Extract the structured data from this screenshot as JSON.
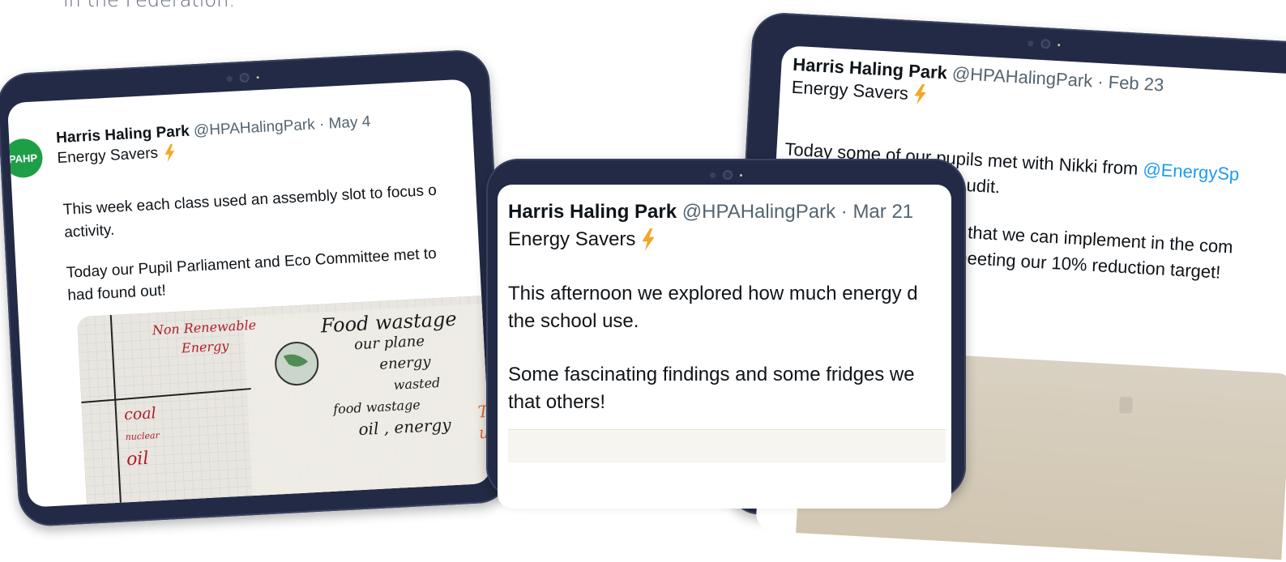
{
  "intro_text": "in the Federation.",
  "colors": {
    "frame": "#232a45",
    "bolt": "#f5a623",
    "handle": "#536471",
    "mention": "#1d9bf0",
    "avatar": "#1e9f47"
  },
  "tweets": [
    {
      "account": "Harris Haling Park",
      "handle": "@HPAHalingPark",
      "date": "May 4",
      "avatar_text": "PAHP",
      "subtitle": "Energy Savers",
      "icon": "lightning-bolt-icon",
      "para1": [
        "This week each class used an assembly slot to focus o",
        "activity."
      ],
      "para2": [
        "Today our Pupil Parliament and Eco Committee met to",
        "had found out!"
      ],
      "photo_text": {
        "left_heading": [
          "Non Renewable",
          "Energy"
        ],
        "left_items": [
          "coal",
          "nuclear",
          "oil"
        ],
        "right_lines": [
          "Food wastage",
          "our plane",
          "energy",
          "wasted",
          "food wastage",
          "oil , energy"
        ],
        "edge_letters": [
          "Th",
          "u"
        ]
      }
    },
    {
      "account": "Harris Haling Park",
      "handle": "@HPAHalingPark",
      "date": "Mar 21",
      "subtitle": "Energy Savers",
      "icon": "lightning-bolt-icon",
      "para1": [
        "This afternoon we explored how much energy d",
        "the school use."
      ],
      "para2": [
        "Some fascinating findings and some fridges we",
        "that others!"
      ]
    },
    {
      "account": "Harris Haling Park",
      "handle": "@HPAHalingPark",
      "date": "Feb 23",
      "subtitle": "Energy Savers",
      "icon": "lightning-bolt-icon",
      "line1_start": "Today some of our pupils met with Nikki from",
      "line1_mention": "@EnergySp",
      "line2": "audit.",
      "line3": "s that we can implement in the com",
      "line4": "meeting our 10% reduction target!"
    }
  ]
}
